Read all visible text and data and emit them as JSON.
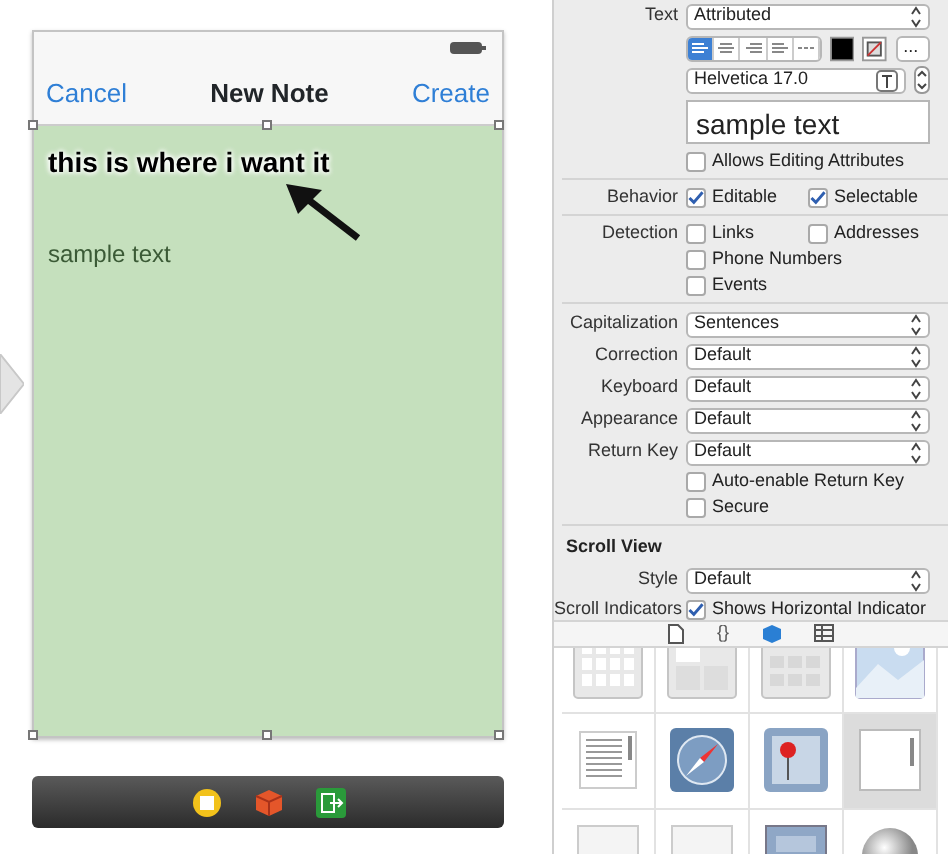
{
  "phone": {
    "nav": {
      "left": "Cancel",
      "title": "New Note",
      "right": "Create"
    },
    "annotation": "this is where i want it",
    "text": "sample text"
  },
  "inspector": {
    "rows": [
      {
        "kind": "select",
        "label": "Text",
        "value": "Attributed"
      },
      {
        "kind": "align",
        "segments": [
          {
            "selected": true
          },
          {
            "selected": false
          },
          {
            "selected": false
          },
          {
            "selected": false
          },
          {
            "selected": false
          }
        ],
        "more": "..."
      },
      {
        "kind": "font",
        "value": "Helvetica 17.0"
      },
      {
        "kind": "textfield",
        "value": "sample text"
      },
      {
        "kind": "check",
        "checks": [
          {
            "label": "Allows Editing Attributes",
            "checked": false
          }
        ]
      },
      {
        "kind": "divider"
      },
      {
        "kind": "check",
        "label": "Behavior",
        "checks": [
          {
            "label": "Editable",
            "checked": true
          },
          {
            "label": "Selectable",
            "checked": true
          }
        ]
      },
      {
        "kind": "divider"
      },
      {
        "kind": "check",
        "label": "Detection",
        "checks": [
          {
            "label": "Links",
            "checked": false
          },
          {
            "label": "Addresses",
            "checked": false
          }
        ]
      },
      {
        "kind": "check",
        "checks": [
          {
            "label": "Phone Numbers",
            "checked": false
          }
        ]
      },
      {
        "kind": "check",
        "checks": [
          {
            "label": "Events",
            "checked": false
          }
        ]
      },
      {
        "kind": "divider"
      },
      {
        "kind": "select",
        "label": "Capitalization",
        "value": "Sentences"
      },
      {
        "kind": "select",
        "label": "Correction",
        "value": "Default"
      },
      {
        "kind": "select",
        "label": "Keyboard",
        "value": "Default"
      },
      {
        "kind": "select",
        "label": "Appearance",
        "value": "Default"
      },
      {
        "kind": "select",
        "label": "Return Key",
        "value": "Default"
      },
      {
        "kind": "check",
        "checks": [
          {
            "label": "Auto-enable Return Key",
            "checked": false
          }
        ]
      },
      {
        "kind": "check",
        "checks": [
          {
            "label": "Secure",
            "checked": false
          }
        ]
      },
      {
        "kind": "divider"
      },
      {
        "kind": "heading",
        "label": "Scroll View"
      },
      {
        "kind": "select",
        "label": "Style",
        "value": "Default"
      },
      {
        "kind": "check",
        "label": "Scroll Indicators",
        "checks": [
          {
            "label": "Shows Horizontal Indicator",
            "checked": true
          }
        ]
      }
    ],
    "tabs": [
      {
        "kind": "file",
        "selected": false
      },
      {
        "kind": "braces",
        "label": "{}",
        "selected": false
      },
      {
        "kind": "cube",
        "selected": true
      },
      {
        "kind": "grid",
        "selected": false
      }
    ]
  },
  "library": [
    {
      "selected": false
    },
    {
      "selected": false
    },
    {
      "selected": false
    },
    {
      "selected": false
    },
    {
      "selected": false
    },
    {
      "selected": false
    },
    {
      "selected": false
    },
    {
      "selected": true
    },
    {
      "selected": false
    },
    {
      "selected": false
    },
    {
      "selected": false
    },
    {
      "selected": false
    }
  ]
}
